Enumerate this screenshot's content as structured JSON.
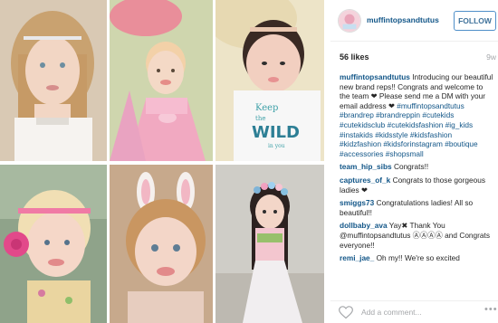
{
  "post": {
    "username": "muffintopsandtutus",
    "follow_label": "FOLLOW",
    "likes": "56 likes",
    "time": "9w",
    "caption": {
      "user": "muffintopsandtutus",
      "text_1": " Introducing our beautiful new brand reps!! Congrats and welcome to the team ",
      "text_2": " Please send me a DM with your email address ",
      "hashtags": "#muffintopsandtutus #brandrep #brandreppin #cutekids #cutekidsclub #cutekidsfashion #ig_kids #instakids #kidsstyle #kidsfashion #kidzfashion #kidsforinstagram #boutique #accessories #shopsmall"
    },
    "comments": [
      {
        "user": "team_hip_sibs",
        "text": " Congrats!!"
      },
      {
        "user": "captures_of_k",
        "text": " Congrats to those gorgeous ladies "
      },
      {
        "user": "smiggs73",
        "text": " Congratulations ladies! All so beautiful!!"
      },
      {
        "user": "dollbaby_ava",
        "text": " Yay✖ Thank You @muffintopsandtutus ⒶⒶⒶⒶ and Congrats everyone!!"
      },
      {
        "user": "remi_jae_",
        "text": " Oh my!! We're so excited"
      }
    ],
    "add_comment_placeholder": "Add a comment...",
    "more_glyph": "•••"
  },
  "icons": {
    "heart": "heart-icon",
    "more": "more-options-icon",
    "emoji": "black-heart-emoji"
  }
}
